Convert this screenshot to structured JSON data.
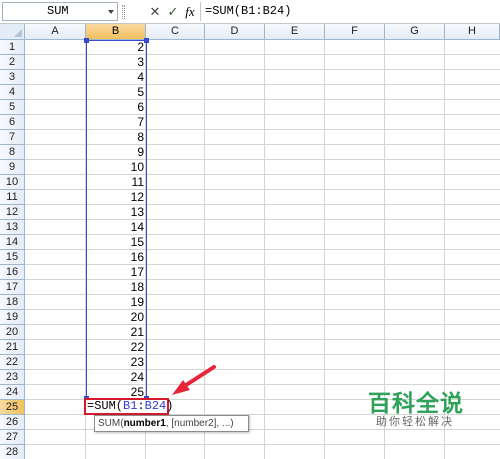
{
  "formula_bar": {
    "name_box": "SUM",
    "cancel_glyph": "✕",
    "enter_glyph": "✓",
    "fx_label": "fx",
    "formula": "=SUM(B1:B24)"
  },
  "columns": [
    "A",
    "B",
    "C",
    "D",
    "E",
    "F",
    "G",
    "H"
  ],
  "active_column": "B",
  "rows": [
    "1",
    "2",
    "3",
    "4",
    "5",
    "6",
    "7",
    "8",
    "9",
    "10",
    "11",
    "12",
    "13",
    "14",
    "15",
    "16",
    "17",
    "18",
    "19",
    "20",
    "21",
    "22",
    "23",
    "24",
    "25",
    "26",
    "27",
    "28"
  ],
  "active_row": "25",
  "column_b_values": [
    "2",
    "3",
    "4",
    "5",
    "6",
    "7",
    "8",
    "9",
    "10",
    "11",
    "12",
    "13",
    "14",
    "15",
    "16",
    "17",
    "18",
    "19",
    "20",
    "21",
    "22",
    "23",
    "24",
    "25"
  ],
  "editing_cell": {
    "prefix": "=SUM(",
    "ref_start": "B1",
    "colon": ":",
    "ref_end": "B24",
    "suffix": ")"
  },
  "tooltip": {
    "func": "SUM(",
    "arg1": "number1",
    "rest": ", [number2], ...)"
  },
  "watermark": {
    "title": "百科全说",
    "subtitle": "助你轻松解决"
  },
  "colors": {
    "range_border": "#3a48c9",
    "edit_border": "#d6192c",
    "annotation_arrow": "#e8263a",
    "watermark_green": "#2fa25a"
  }
}
